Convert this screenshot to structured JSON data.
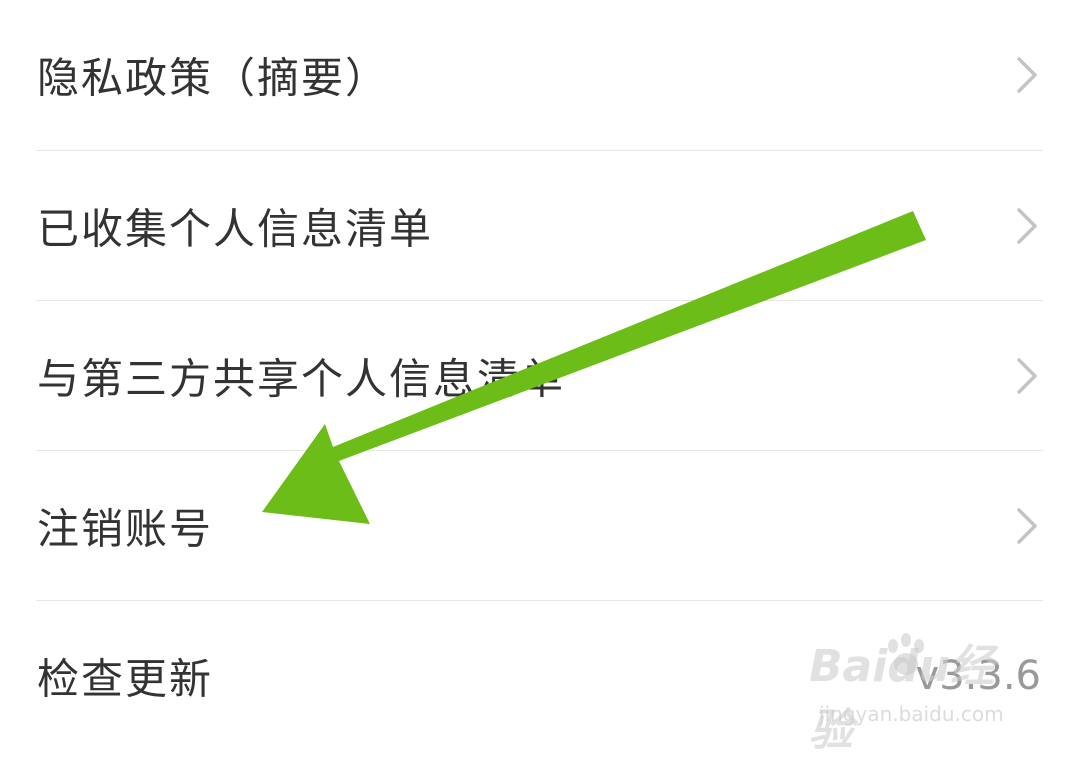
{
  "settings_list": {
    "items": [
      {
        "label": "隐私政策（摘要）",
        "has_chevron": true
      },
      {
        "label": "已收集个人信息清单",
        "has_chevron": true
      },
      {
        "label": "与第三方共享个人信息清单",
        "has_chevron": true
      },
      {
        "label": "注销账号",
        "has_chevron": true
      },
      {
        "label": "检查更新",
        "value": "v3.3.6",
        "has_chevron": false
      }
    ]
  },
  "annotation": {
    "type": "arrow",
    "color": "#6cbd17",
    "points_to": "注销账号"
  },
  "watermark": {
    "logo_text": "Baidu经验",
    "sub_text": "jingyan.baidu.com"
  },
  "icons": {
    "chevron": "chevron-right-icon"
  }
}
